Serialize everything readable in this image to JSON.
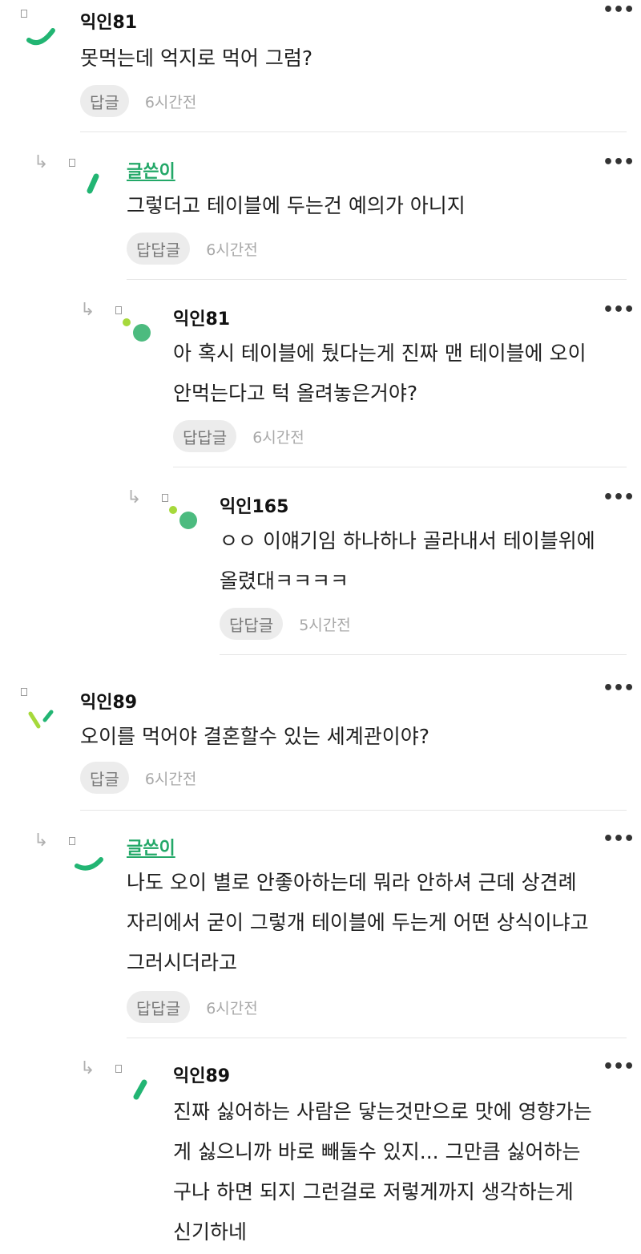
{
  "comments": [
    {
      "author": "익인81",
      "lines": [
        "못먹는데 억지로 먹어 그럼?"
      ],
      "reply_label": "답글",
      "time": "6시간전"
    },
    {
      "author": "글쓴이",
      "lines": [
        "그렇더고 테이블에 두는건 예의가 아니지"
      ],
      "reply_label": "답답글",
      "time": "6시간전"
    },
    {
      "author": "익인81",
      "lines": [
        "아 혹시 테이블에 뒀다는게 진짜 맨 테이블에 오이",
        "안먹는다고 턱 올려놓은거야?"
      ],
      "reply_label": "답답글",
      "time": "6시간전"
    },
    {
      "author": "익인165",
      "lines": [
        "ㅇㅇ 이얘기임 하나하나 골라내서 테이블위에",
        "올렸대ㅋㅋㅋㅋ"
      ],
      "reply_label": "답답글",
      "time": "5시간전"
    },
    {
      "author": "익인89",
      "lines": [
        "오이를 먹어야 결혼할수 있는 세계관이야?"
      ],
      "reply_label": "답글",
      "time": "6시간전"
    },
    {
      "author": "글쓴이",
      "lines": [
        "나도 오이 별로 안좋아하는데 뭐라 안하셔 근데 상견례",
        "자리에서 굳이 그렇개 테이블에 두는게 어떤 상식이냐고",
        "그러시더라고"
      ],
      "reply_label": "답답글",
      "time": "6시간전"
    },
    {
      "author": "익인89",
      "lines": [
        "진짜 싫어하는 사람은 닿는것만으로 맛에 영향가는",
        "게 싫으니까 바로 빼둘수 있지... 그만큼 싫어하는",
        "구나 하면 되지 그런걸로 저렇게까지 생각하는게",
        "신기하네"
      ]
    }
  ],
  "icons": {
    "more": "more-dots-icon",
    "reply": "reply-arrow-icon",
    "avatar": "avatar-image-icon"
  },
  "colors": {
    "op_author": "#23a868",
    "avatar_green": "#22b573",
    "avatar_lime": "#a6d93b",
    "avatar_teal": "#4cbb7f"
  },
  "ui": {
    "more_symbol": "•••",
    "reply_arrow": "↳"
  }
}
